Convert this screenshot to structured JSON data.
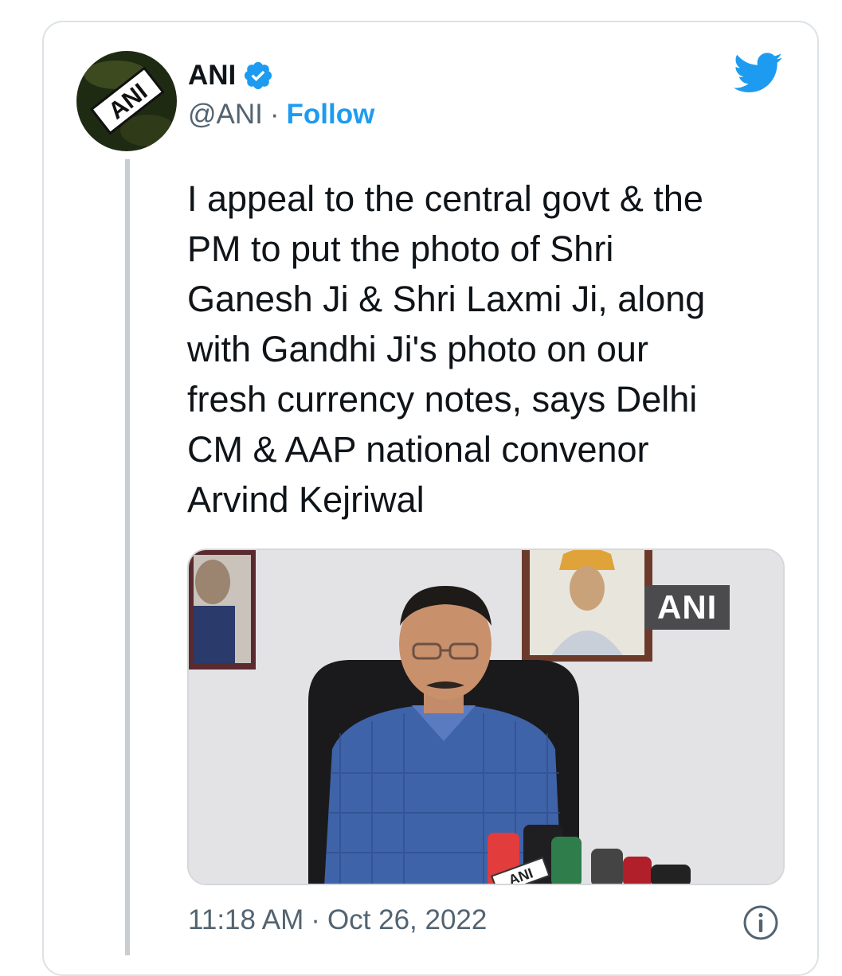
{
  "tweet": {
    "author": {
      "name": "ANI",
      "handle": "@ANI",
      "follow_label": "Follow",
      "verified": true,
      "avatar_text": "ANI"
    },
    "separator": "·",
    "text": "I appeal to the central govt & the\nPM to put the photo of Shri\nGanesh Ji & Shri Laxmi Ji, along\nwith Gandhi Ji's photo on our\nfresh currency notes, says Delhi\nCM & AAP national convenor\nArvind Kejriwal",
    "media": {
      "watermark": "ANI",
      "mic_label": "ANI"
    },
    "time": "11:18 AM",
    "date": "Oct 26, 2022"
  },
  "icons": {
    "verified": "verified-badge-icon",
    "twitter": "twitter-bird-icon",
    "info": "info-icon"
  },
  "colors": {
    "accent": "#1d9bf0",
    "text": "#0f1419",
    "secondary_text": "#536471",
    "border": "#dde2e6"
  }
}
